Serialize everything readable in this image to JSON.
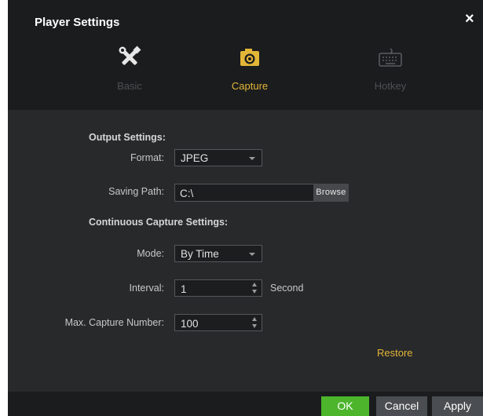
{
  "window": {
    "title": "Player Settings",
    "close_glyph": "×"
  },
  "tabs": [
    {
      "label": "Basic",
      "icon": "tools-icon",
      "active": false
    },
    {
      "label": "Capture",
      "icon": "camera-icon",
      "active": true
    },
    {
      "label": "Hotkey",
      "icon": "keyboard-icon",
      "active": false
    }
  ],
  "output": {
    "heading": "Output Settings:",
    "format_label": "Format:",
    "format_value": "JPEG",
    "path_label": "Saving Path:",
    "path_value": "C:\\",
    "browse_label": "Browse"
  },
  "continuous": {
    "heading": "Continuous Capture Settings:",
    "mode_label": "Mode:",
    "mode_value": "By Time",
    "interval_label": "Interval:",
    "interval_value": "1",
    "interval_unit": "Second",
    "max_label": "Max. Capture Number:",
    "max_value": "100"
  },
  "restore_label": "Restore",
  "footer": {
    "ok": "OK",
    "cancel": "Cancel",
    "apply": "Apply"
  },
  "colors": {
    "accent": "#e2b637",
    "ok_green": "#4cb52c",
    "panel_bg": "#28292b",
    "header_bg": "#1b1c1e"
  }
}
